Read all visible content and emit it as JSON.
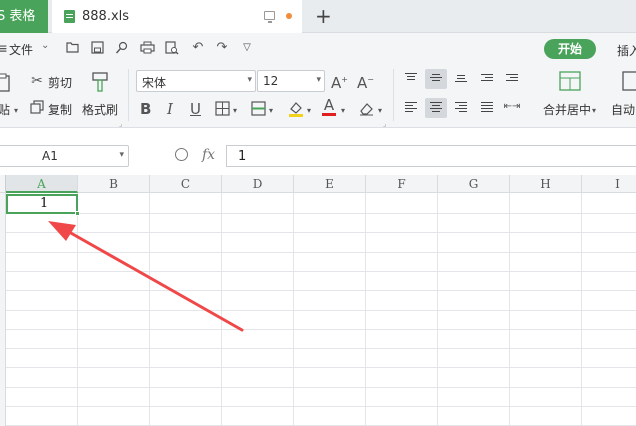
{
  "tabs": {
    "app_label": "S 表格",
    "doc_label": "888.xls"
  },
  "menu": {
    "file_label": "文件",
    "start_label": "开始",
    "insert_label": "插入"
  },
  "ribbon": {
    "cut_label": "剪切",
    "paste_label": "贴",
    "copy_label": "复制",
    "format_painter_label": "格式刷",
    "font_name": "宋体",
    "font_size": "12",
    "merge_label": "合并居中",
    "auto_label": "自动"
  },
  "formula_bar": {
    "cell_ref": "A1",
    "fx_label": "fx",
    "value": "1"
  },
  "grid": {
    "columns": [
      "A",
      "B",
      "C",
      "D",
      "E",
      "F",
      "G",
      "H",
      "I"
    ],
    "a1_value": "1"
  },
  "colors": {
    "accent": "#4aa35a",
    "arrow": "#f04848",
    "dirty_dot": "#f08c3a"
  }
}
